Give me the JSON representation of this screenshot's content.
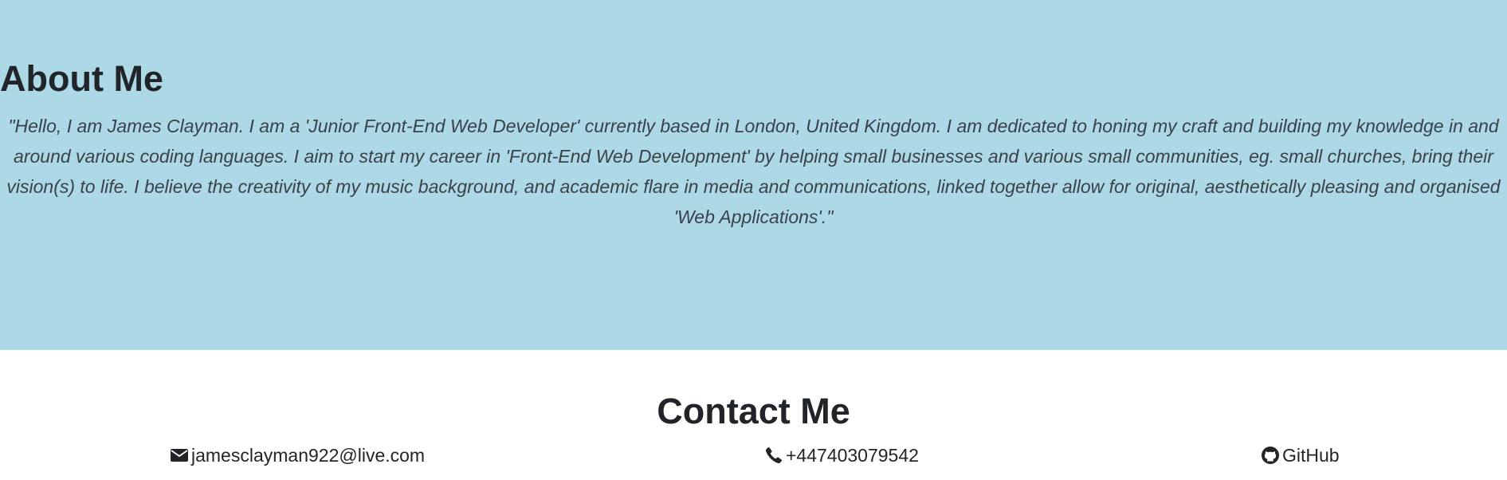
{
  "about": {
    "heading": "About Me",
    "text": "\"Hello, I am James Clayman. I am a 'Junior Front-End Web Developer' currently based in London, United Kingdom. I am dedicated to honing my craft and building my knowledge in and around various coding languages. I aim to start my career in 'Front-End Web Development' by helping small businesses and various small communities, eg. small churches, bring their vision(s) to life. I believe the creativity of my music background, and academic flare in media and communications, linked together allow for original, aesthetically pleasing and organised 'Web Applications'.\""
  },
  "contact": {
    "heading": "Contact Me",
    "email": {
      "icon": "envelope-icon",
      "label": "jamesclayman922@live.com"
    },
    "phone": {
      "icon": "phone-icon",
      "label": "+447403079542"
    },
    "github": {
      "icon": "github-icon",
      "label": "GitHub"
    }
  },
  "colors": {
    "about_background": "#add8e6",
    "text": "#212529"
  }
}
